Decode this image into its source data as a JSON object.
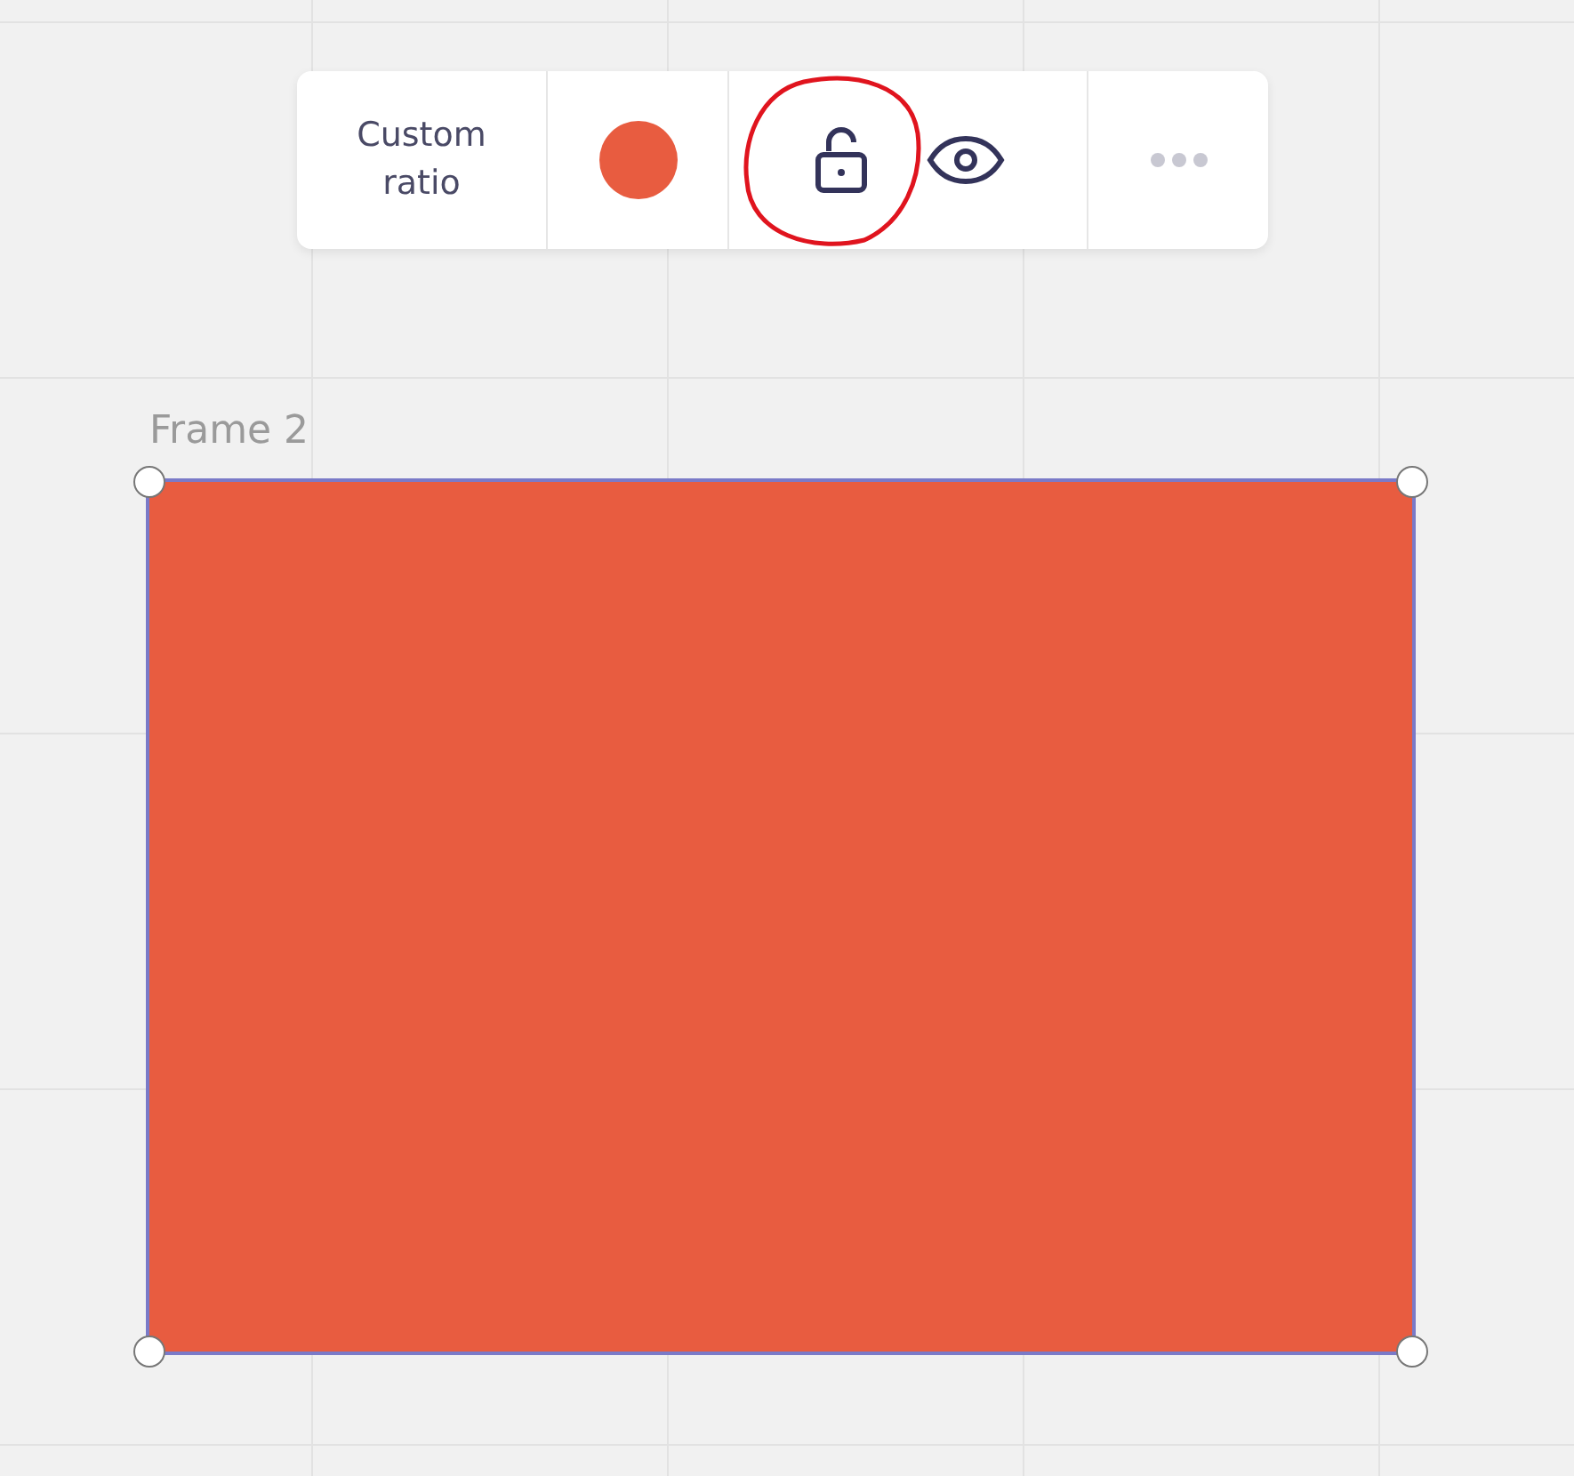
{
  "toolbar": {
    "ratio_label": "Custom ratio",
    "swatch": {
      "color": "#e85c40"
    },
    "locked": false,
    "visible": true
  },
  "frame": {
    "title": "Frame 2",
    "color": "#e85c40",
    "selected": true
  }
}
